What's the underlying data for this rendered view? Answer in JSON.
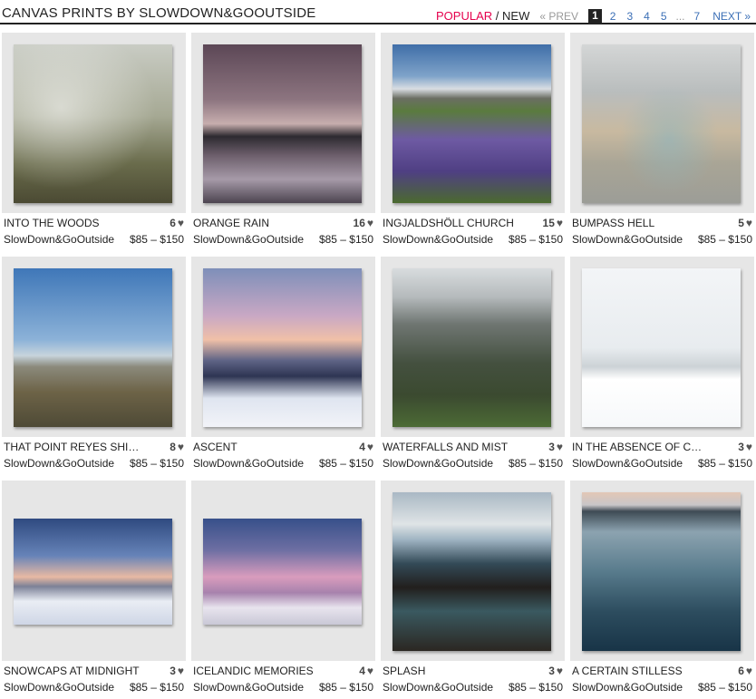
{
  "header": {
    "title": "CANVAS PRINTS BY SLOWDOWN&GOOUTSIDE",
    "sort": {
      "popular": "POPULAR",
      "separator": "/",
      "new": "NEW"
    },
    "pager": {
      "prev": "« PREV",
      "current": "1",
      "pages": [
        "2",
        "3",
        "4",
        "5"
      ],
      "ellipsis": "...",
      "last": "7",
      "next": "NEXT »"
    }
  },
  "items": [
    {
      "title": "INTO THE WOODS",
      "likes": "6",
      "artist": "SlowDown&GoOutside",
      "price": "$85 – $150"
    },
    {
      "title": "ORANGE RAIN",
      "likes": "16",
      "artist": "SlowDown&GoOutside",
      "price": "$85 – $150"
    },
    {
      "title": "INGJALDSHÖLL CHURCH",
      "likes": "15",
      "artist": "SlowDown&GoOutside",
      "price": "$85 – $150"
    },
    {
      "title": "BUMPASS HELL",
      "likes": "5",
      "artist": "SlowDown&GoOutside",
      "price": "$85 – $150"
    },
    {
      "title": "THAT POINT REYES SHIP...",
      "likes": "8",
      "artist": "SlowDown&GoOutside",
      "price": "$85 – $150"
    },
    {
      "title": "ASCENT",
      "likes": "4",
      "artist": "SlowDown&GoOutside",
      "price": "$85 – $150"
    },
    {
      "title": "WATERFALLS AND MIST",
      "likes": "3",
      "artist": "SlowDown&GoOutside",
      "price": "$85 – $150"
    },
    {
      "title": "IN THE ABSENCE OF CO...",
      "likes": "3",
      "artist": "SlowDown&GoOutside",
      "price": "$85 – $150"
    },
    {
      "title": "SNOWCAPS AT MIDNIGHT",
      "likes": "3",
      "artist": "SlowDown&GoOutside",
      "price": "$85 – $150"
    },
    {
      "title": "ICELANDIC MEMORIES",
      "likes": "4",
      "artist": "SlowDown&GoOutside",
      "price": "$85 – $150"
    },
    {
      "title": "SPLASH",
      "likes": "3",
      "artist": "SlowDown&GoOutside",
      "price": "$85 – $150"
    },
    {
      "title": "A CERTAIN STILLESS",
      "likes": "6",
      "artist": "SlowDown&GoOutside",
      "price": "$85 – $150"
    }
  ],
  "icons": {
    "like": "heart-icon"
  },
  "colors": {
    "accent": "#e5004d",
    "link": "#3b6fb6"
  }
}
